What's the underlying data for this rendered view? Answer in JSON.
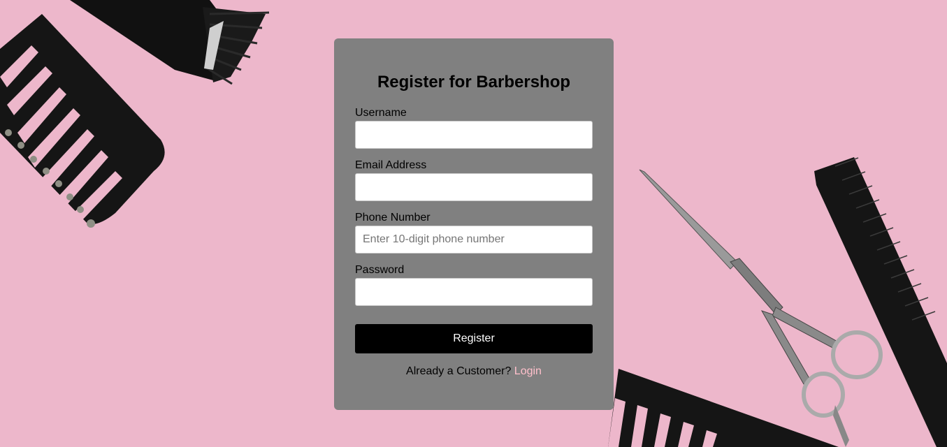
{
  "colors": {
    "background": "#edb7cb",
    "card": "#808080",
    "button": "#000000",
    "button_text": "#ffffff",
    "link": "#ffc0cb"
  },
  "form": {
    "title": "Register for Barbershop",
    "fields": [
      {
        "label": "Username",
        "value": "",
        "placeholder": ""
      },
      {
        "label": "Email Address",
        "value": "",
        "placeholder": ""
      },
      {
        "label": "Phone Number",
        "value": "",
        "placeholder": "Enter 10-digit phone number"
      },
      {
        "label": "Password",
        "value": "",
        "placeholder": ""
      }
    ],
    "submit_label": "Register",
    "login_prompt": "Already a Customer?",
    "login_link": "Login"
  },
  "background_items": [
    "hair-clipper-icon",
    "wide-comb-icon",
    "scissors-icon",
    "fine-comb-icon",
    "comb-icon"
  ]
}
